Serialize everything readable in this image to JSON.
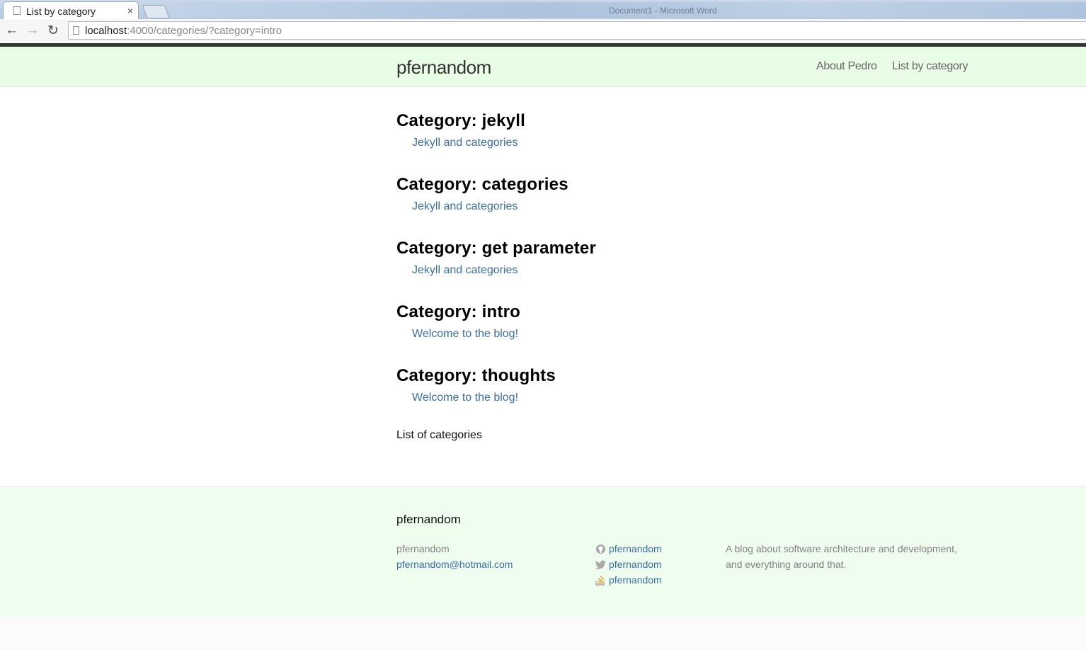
{
  "browser": {
    "tab_title": "List by category",
    "tab_close": "×",
    "taskbar_text": "Document1 - Microsoft Word",
    "url_host": "localhost",
    "url_rest": ":4000/categories/?category=intro",
    "back": "←",
    "forward": "→",
    "reload": "↻"
  },
  "header": {
    "site_title": "pfernandom",
    "nav": [
      "About Pedro",
      "List by category"
    ]
  },
  "categories": [
    {
      "title": "Category: jekyll",
      "post": "Jekyll and categories"
    },
    {
      "title": "Category: categories",
      "post": "Jekyll and categories"
    },
    {
      "title": "Category: get parameter",
      "post": "Jekyll and categories"
    },
    {
      "title": "Category: intro",
      "post": "Welcome to the blog!"
    },
    {
      "title": "Category: thoughts",
      "post": "Welcome to the blog!"
    }
  ],
  "list_label": "List of categories",
  "footer": {
    "heading": "pfernandom",
    "name": "pfernandom",
    "email": "pfernandom@hotmail.com",
    "social": [
      {
        "icon": "github-icon",
        "label": "pfernandom"
      },
      {
        "icon": "twitter-icon",
        "label": "pfernandom"
      },
      {
        "icon": "stackoverflow-icon",
        "label": "pfernandom"
      }
    ],
    "description": "A blog about software architecture and development, and everything around that."
  },
  "colors": {
    "header_bg": "#e9fce5",
    "footer_bg": "#effdee",
    "link": "#3a6ea5"
  }
}
